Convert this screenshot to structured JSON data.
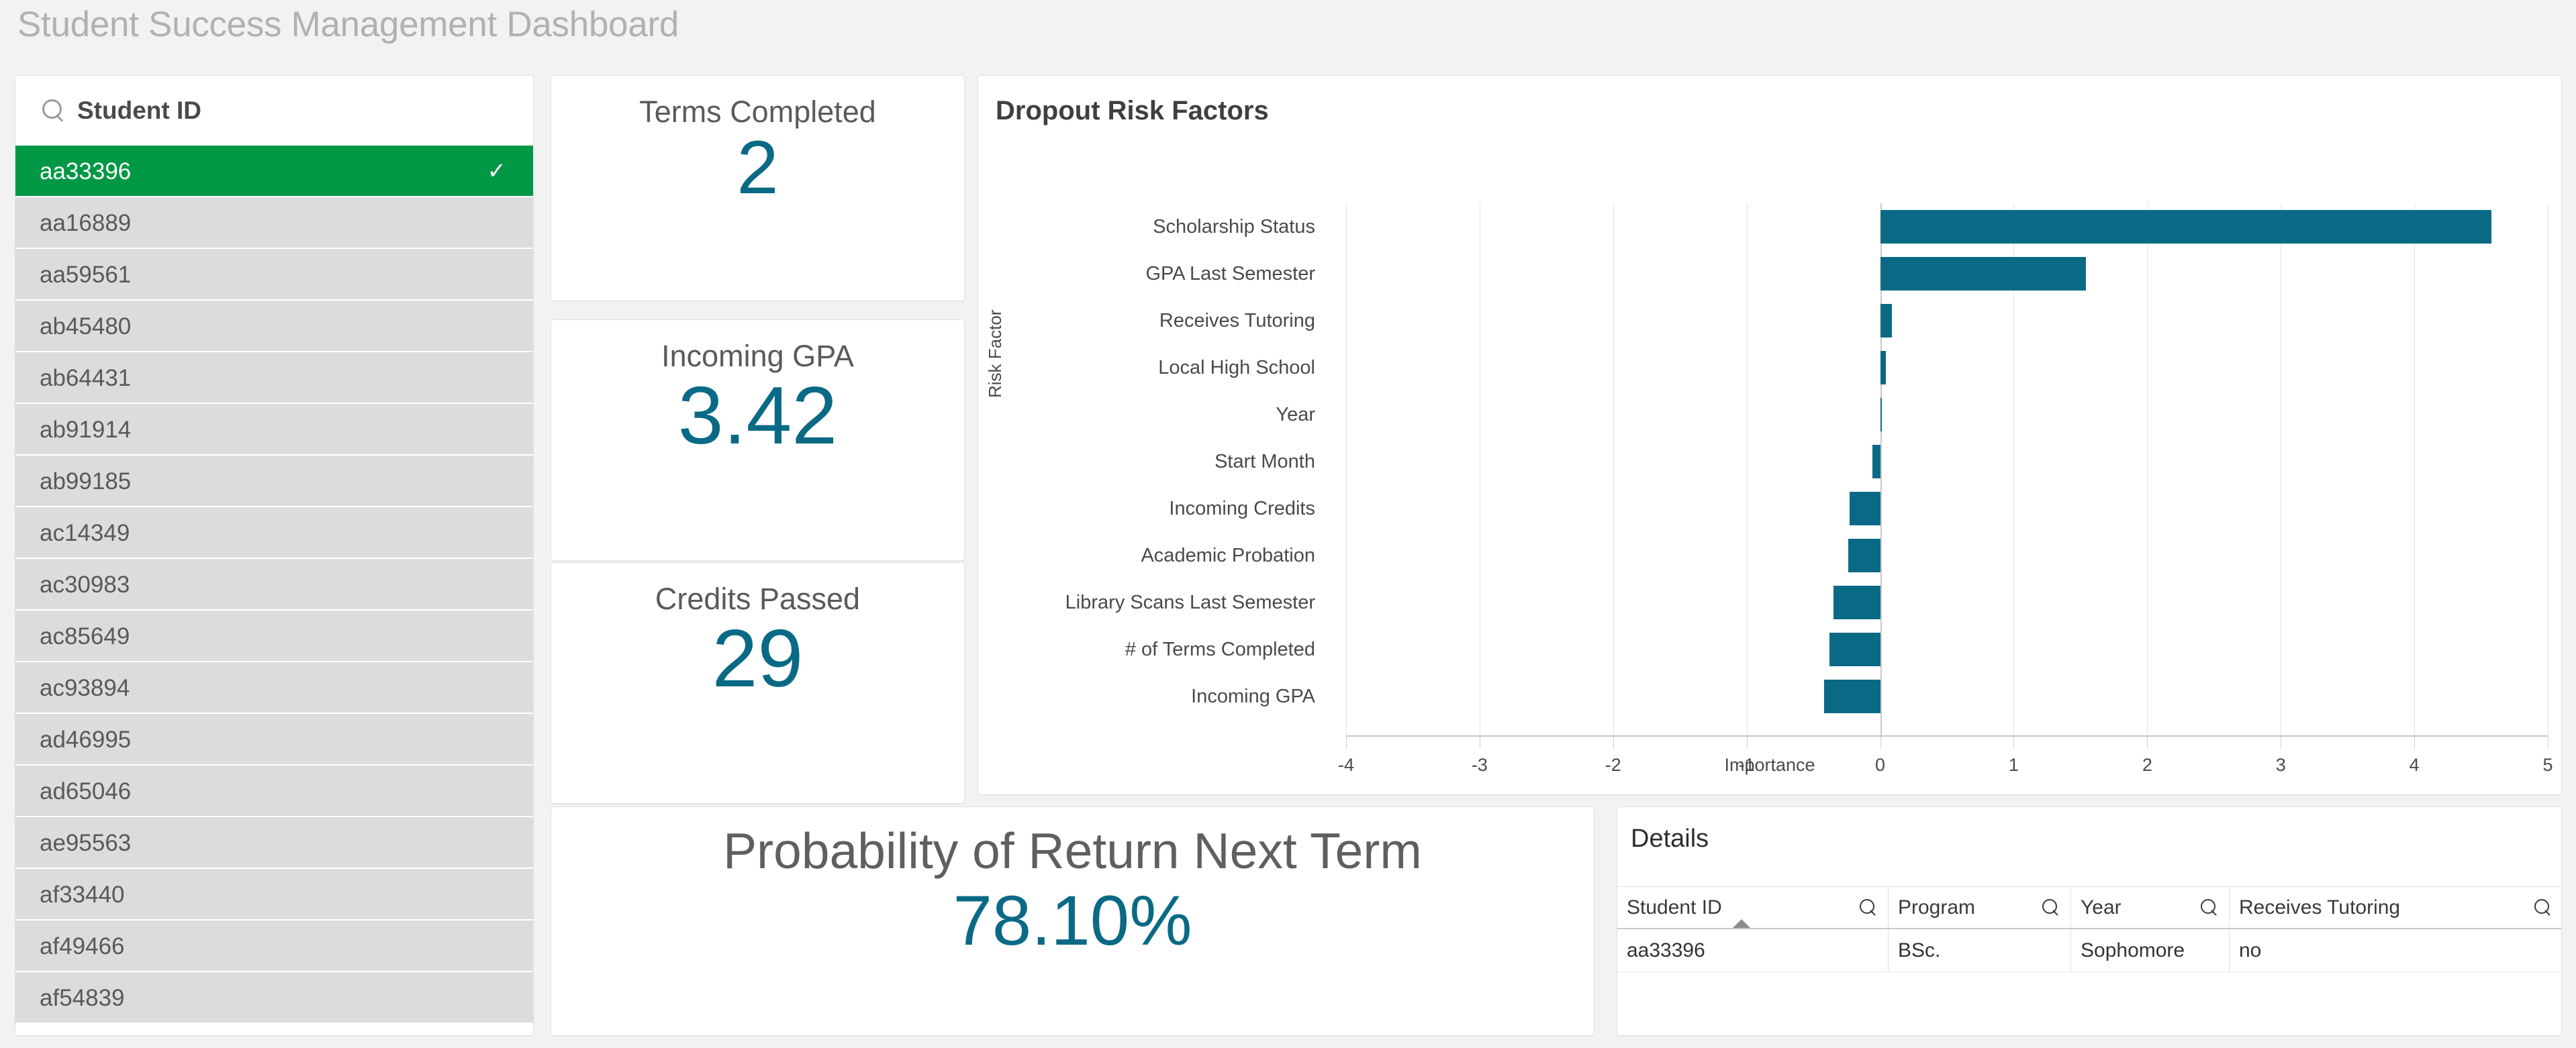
{
  "app": {
    "title": "Student Success Management Dashboard"
  },
  "colors": {
    "accent_teal": "#0a6a85",
    "selection_green": "#009845",
    "page_bg": "#f2f2f2",
    "list_item_bg": "#dcdcdc"
  },
  "filter": {
    "search_placeholder": "Student ID",
    "search_icon": "search-icon",
    "selected_tick": "✓",
    "items": [
      {
        "id": "aa33396",
        "selected": true
      },
      {
        "id": "aa16889",
        "selected": false
      },
      {
        "id": "aa59561",
        "selected": false
      },
      {
        "id": "ab45480",
        "selected": false
      },
      {
        "id": "ab64431",
        "selected": false
      },
      {
        "id": "ab91914",
        "selected": false
      },
      {
        "id": "ab99185",
        "selected": false
      },
      {
        "id": "ac14349",
        "selected": false
      },
      {
        "id": "ac30983",
        "selected": false
      },
      {
        "id": "ac85649",
        "selected": false
      },
      {
        "id": "ac93894",
        "selected": false
      },
      {
        "id": "ad46995",
        "selected": false
      },
      {
        "id": "ad65046",
        "selected": false
      },
      {
        "id": "ae95563",
        "selected": false
      },
      {
        "id": "af33440",
        "selected": false
      },
      {
        "id": "af49466",
        "selected": false
      },
      {
        "id": "af54839",
        "selected": false
      }
    ]
  },
  "kpis": {
    "terms_completed": {
      "title": "Terms Completed",
      "value": "2"
    },
    "incoming_gpa": {
      "title": "Incoming GPA",
      "value": "3.42"
    },
    "credits_passed": {
      "title": "Credits Passed",
      "value": "29"
    },
    "probability": {
      "title": "Probability of Return Next Term",
      "value": "78.10%"
    }
  },
  "chart_data": {
    "type": "bar",
    "orientation": "horizontal",
    "title": "Dropout Risk Factors",
    "xlabel": "Importance",
    "ylabel": "Risk Factor",
    "xlim": [
      -4,
      5
    ],
    "xticks": [
      "-4",
      "-3",
      "-2",
      "-1",
      "0",
      "1",
      "2",
      "3",
      "4",
      "5"
    ],
    "xtick_values": [
      -4,
      -3,
      -2,
      -1,
      0,
      1,
      2,
      3,
      4,
      5
    ],
    "grid": true,
    "legend": "none",
    "bar_color": "#0a6a85",
    "categories": [
      "Scholarship Status",
      "GPA Last Semester",
      "Receives Tutoring",
      "Local High School",
      "Year",
      "Start Month",
      "Incoming Credits",
      "Academic Probation",
      "Library Scans Last Semester",
      "# of Terms Completed",
      "Incoming GPA"
    ],
    "values": [
      4.58,
      1.54,
      0.09,
      0.04,
      0.01,
      -0.06,
      -0.23,
      -0.24,
      -0.35,
      -0.38,
      -0.42
    ]
  },
  "details": {
    "title": "Details",
    "search_icon": "search-icon",
    "sort_column": "Student ID",
    "sort_direction": "ascending",
    "columns": [
      "Student ID",
      "Program",
      "Year",
      "Receives Tutoring"
    ],
    "rows": [
      [
        "aa33396",
        "BSc.",
        "Sophomore",
        "no"
      ]
    ]
  }
}
